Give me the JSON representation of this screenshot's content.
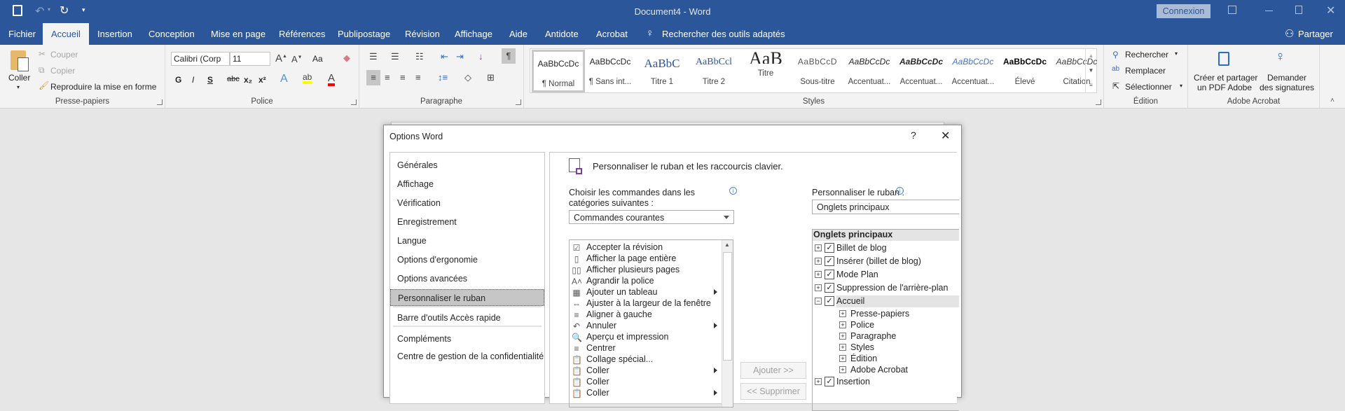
{
  "window": {
    "title": "Document4 - Word",
    "signin": "Connexion"
  },
  "quick_access": {
    "icons": [
      "save-icon",
      "undo-icon",
      "redo-icon",
      "customize-icon"
    ]
  },
  "tabs": [
    "Fichier",
    "Accueil",
    "Insertion",
    "Conception",
    "Mise en page",
    "Références",
    "Publipostage",
    "Révision",
    "Affichage",
    "Aide",
    "Antidote",
    "Acrobat"
  ],
  "active_tab": "Accueil",
  "tell_me": "Rechercher des outils adaptés",
  "share": "Partager",
  "ribbon": {
    "clipboard": {
      "label": "Presse-papiers",
      "paste": "Coller",
      "cut": "Couper",
      "copy": "Copier",
      "format_painter": "Reproduire la mise en forme"
    },
    "font": {
      "label": "Police",
      "font_name": "Calibri (Corp",
      "font_size": "11",
      "change_case": "Aa",
      "bold": "G",
      "italic": "I",
      "underline": "S",
      "strike": "abc",
      "sub": "x₂",
      "sup": "x²"
    },
    "paragraph": {
      "label": "Paragraphe"
    },
    "styles": {
      "label": "Styles",
      "items": [
        {
          "preview": "AaBbCcDc",
          "name": "¶ Normal"
        },
        {
          "preview": "AaBbCcDc",
          "name": "¶ Sans int..."
        },
        {
          "preview": "AaBbC",
          "name": "Titre 1"
        },
        {
          "preview": "AaBbCcl",
          "name": "Titre 2"
        },
        {
          "preview": "AaB",
          "name": "Titre"
        },
        {
          "preview": "AaBbCcD",
          "name": "Sous-titre"
        },
        {
          "preview": "AaBbCcDc",
          "name": "Accentuat..."
        },
        {
          "preview": "AaBbCcDc",
          "name": "Accentuat..."
        },
        {
          "preview": "AaBbCcDc",
          "name": "Accentuat..."
        },
        {
          "preview": "AaBbCcDc",
          "name": "Élevé"
        },
        {
          "preview": "AaBbCcDc",
          "name": "Citation"
        }
      ]
    },
    "editing": {
      "label": "Édition",
      "find": "Rechercher",
      "replace": "Remplacer",
      "select": "Sélectionner"
    },
    "acrobat": {
      "label": "Adobe Acrobat",
      "create_line1": "Créer et partager",
      "create_line2": "un PDF Adobe",
      "sign_line1": "Demander",
      "sign_line2": "des signatures"
    }
  },
  "dialog": {
    "title": "Options Word",
    "help": "?",
    "nav": [
      "Générales",
      "Affichage",
      "Vérification",
      "Enregistrement",
      "Langue",
      "Options d'ergonomie",
      "Options avancées",
      "Personnaliser le ruban",
      "Barre d'outils Accès rapide",
      "Compléments",
      "Centre de gestion de la confidentialité"
    ],
    "nav_selected": "Personnaliser le ruban",
    "heading": "Personnaliser le ruban et les raccourcis clavier.",
    "choose_label_1": "Choisir les commandes dans les",
    "choose_label_2": "catégories suivantes :",
    "choose_value": "Commandes courantes",
    "customize_label": "Personnaliser le ruban :",
    "customize_value": "Onglets principaux",
    "commands": [
      {
        "label": "Accepter la révision",
        "icon": "accept-revision-icon",
        "g": "☑"
      },
      {
        "label": "Afficher la page entière",
        "icon": "one-page-icon",
        "g": "▯"
      },
      {
        "label": "Afficher plusieurs pages",
        "icon": "multiple-pages-icon",
        "g": "▯▯"
      },
      {
        "label": "Agrandir la police",
        "icon": "grow-font-icon",
        "g": "A˄"
      },
      {
        "label": "Ajouter un tableau",
        "icon": "table-icon",
        "g": "▦",
        "sub": true
      },
      {
        "label": "Ajuster à la largeur de la fenêtre",
        "icon": "page-width-icon",
        "g": "⇔"
      },
      {
        "label": "Aligner à gauche",
        "icon": "align-left-icon",
        "g": "≡"
      },
      {
        "label": "Annuler",
        "icon": "undo-icon",
        "g": "↶",
        "sub": true
      },
      {
        "label": "Aperçu et impression",
        "icon": "print-preview-icon",
        "g": "🔍"
      },
      {
        "label": "Centrer",
        "icon": "align-center-icon",
        "g": "≡"
      },
      {
        "label": "Collage spécial...",
        "icon": "paste-special-icon",
        "g": "📋"
      },
      {
        "label": "Coller",
        "icon": "paste-icon",
        "g": "📋",
        "sub": true
      },
      {
        "label": "Coller",
        "icon": "paste-icon",
        "g": "📋"
      },
      {
        "label": "Coller",
        "icon": "paste-icon",
        "g": "📋",
        "sub": true
      }
    ],
    "add_button": "Ajouter >>",
    "remove_button": "<< Supprimer",
    "tree_header": "Onglets principaux",
    "tree": [
      {
        "label": "Billet de blog",
        "checked": true,
        "level": 0,
        "expanded": false
      },
      {
        "label": "Insérer (billet de blog)",
        "checked": true,
        "level": 0,
        "expanded": false
      },
      {
        "label": "Mode Plan",
        "checked": true,
        "level": 0,
        "expanded": false
      },
      {
        "label": "Suppression de l'arrière-plan",
        "checked": true,
        "level": 0,
        "expanded": false
      },
      {
        "label": "Accueil",
        "checked": true,
        "level": 0,
        "expanded": true,
        "selected": true
      },
      {
        "label": "Presse-papiers",
        "level": 1
      },
      {
        "label": "Police",
        "level": 1
      },
      {
        "label": "Paragraphe",
        "level": 1
      },
      {
        "label": "Styles",
        "level": 1
      },
      {
        "label": "Édition",
        "level": 1
      },
      {
        "label": "Adobe Acrobat",
        "level": 1
      },
      {
        "label": "Insertion",
        "checked": true,
        "level": 0,
        "expanded": false
      }
    ]
  },
  "colors": {
    "brand": "#2b579a",
    "ribbon_bg": "#f3f3f3",
    "selection": "#c6c6c6",
    "highlight": "#ffff00",
    "font_color": "#ff0000"
  }
}
